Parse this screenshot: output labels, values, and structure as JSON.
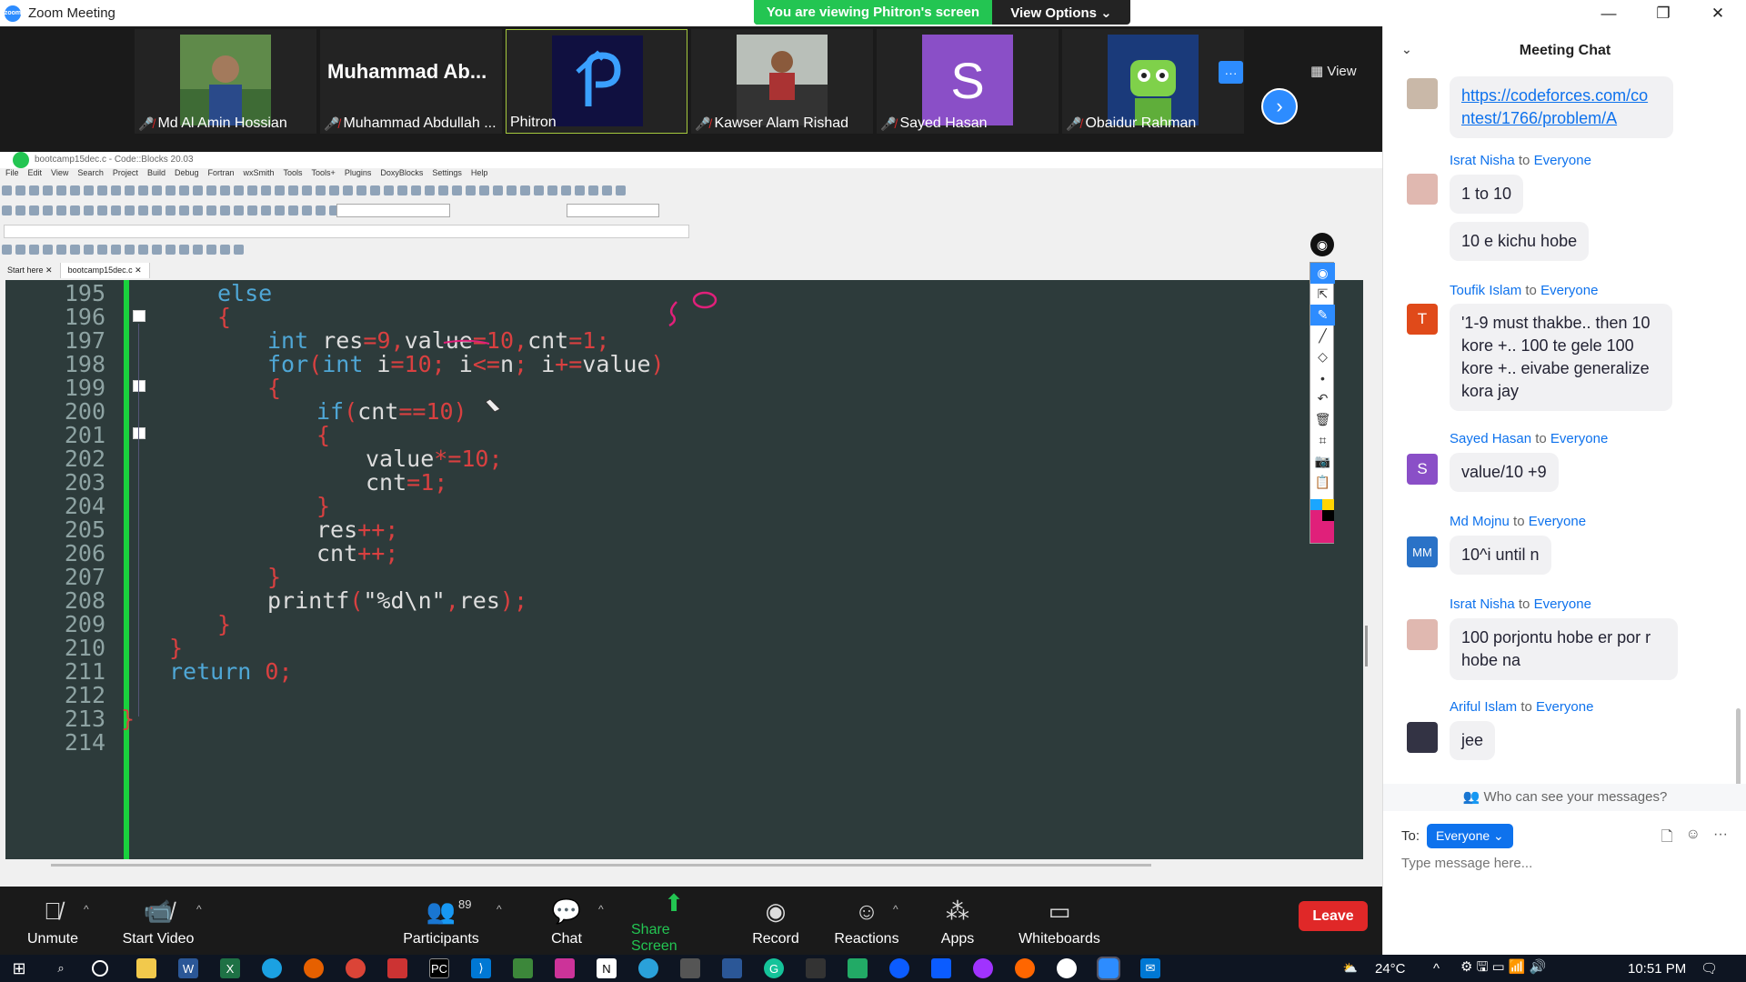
{
  "window": {
    "title": "Zoom Meeting"
  },
  "banner": {
    "viewing": "You are viewing Phitron's screen",
    "view_options": "View Options ⌄"
  },
  "video_tiles": [
    {
      "name": "Md Al Amin Hossian",
      "muted": true
    },
    {
      "name": "Muhammad Abdullah ...",
      "muted": true,
      "big_label": "Muhammad  Ab..."
    },
    {
      "name": "Phitron",
      "muted": false
    },
    {
      "name": "Kawser Alam Rishad",
      "muted": true
    },
    {
      "name": "Sayed Hasan",
      "muted": true,
      "initial": "S"
    },
    {
      "name": "Obaidur Rahman",
      "muted": true
    }
  ],
  "strip": {
    "more": "···",
    "view": "View"
  },
  "codeblocks": {
    "title": "bootcamp15dec.c - Code::Blocks 20.03",
    "menu": [
      "File",
      "Edit",
      "View",
      "Search",
      "Project",
      "Build",
      "Debug",
      "Fortran",
      "wxSmith",
      "Tools",
      "Tools+",
      "Plugins",
      "DoxyBlocks",
      "Settings",
      "Help"
    ],
    "tabs": [
      "Start here",
      "bootcamp15dec.c"
    ],
    "line_numbers": [
      "195",
      "196",
      "197",
      "198",
      "199",
      "200",
      "201",
      "202",
      "203",
      "204",
      "205",
      "206",
      "207",
      "208",
      "209",
      "210",
      "211",
      "212",
      "213",
      "214"
    ]
  },
  "chat": {
    "title": "Meeting Chat",
    "messages": [
      {
        "sender": "",
        "to": "",
        "text": "https://codeforces.com/contest/1766/problem/A",
        "link_line1": "https://codeforces.com/co",
        "link_line2": "ntest/1766/problem/A"
      },
      {
        "sender": "Israt Nisha",
        "to": "Everyone",
        "text": "1 to 10"
      },
      {
        "sender": "",
        "to": "",
        "text": "10 e kichu hobe"
      },
      {
        "sender": "Toufik Islam",
        "to": "Everyone",
        "avatar": "T",
        "text_lines": [
          "'1-9 must thakbe.. then 10",
          "kore +.. 100 te gele 100",
          "kore +.. eivabe generalize",
          "kora jay"
        ]
      },
      {
        "sender": "Sayed Hasan",
        "to": "Everyone",
        "avatar": "S",
        "text": "value/10 +9"
      },
      {
        "sender": "Md Mojnu",
        "to": "Everyone",
        "avatar": "MM",
        "text": "10^i until n"
      },
      {
        "sender": "Israt Nisha",
        "to": "Everyone",
        "text_lines": [
          "100 porjontu hobe er por r",
          "hobe na"
        ]
      },
      {
        "sender": "Ariful Islam",
        "to": "Everyone",
        "text": "jee"
      }
    ],
    "to_word": "to",
    "who_can_see": "Who can see your messages?",
    "to_label": "To:",
    "to_value": "Everyone",
    "input_placeholder": "Type message here..."
  },
  "controls": {
    "unmute": "Unmute",
    "start_video": "Start Video",
    "participants": "Participants",
    "participant_count": "89",
    "chat": "Chat",
    "share_screen": "Share Screen",
    "record": "Record",
    "reactions": "Reactions",
    "apps": "Apps",
    "whiteboards": "Whiteboards",
    "leave": "Leave"
  },
  "taskbar": {
    "temperature": "24°C",
    "time": "10:51 PM"
  },
  "colors": {
    "zoom_blue": "#2d8cff",
    "green": "#23c552",
    "leave_red": "#e02828",
    "editor_bg": "#2d3b3b",
    "annotation_pink": "#e0207a"
  }
}
